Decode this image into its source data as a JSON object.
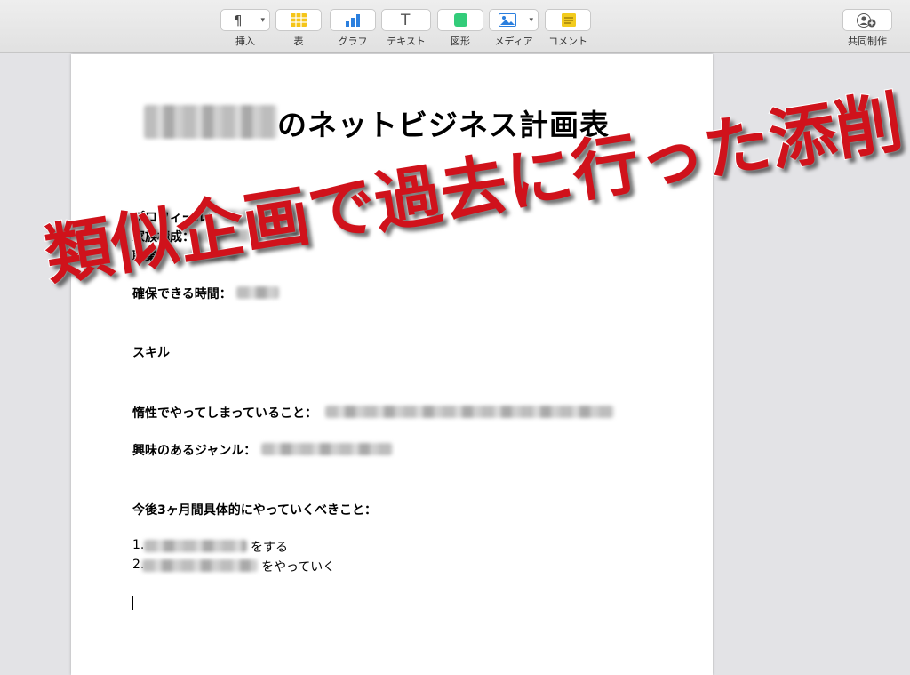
{
  "toolbar": {
    "tools": [
      {
        "name": "insert",
        "label": "挿入",
        "glyph": "¶"
      },
      {
        "name": "table",
        "label": "表"
      },
      {
        "name": "chart",
        "label": "グラフ"
      },
      {
        "name": "text",
        "label": "テキスト",
        "glyph": "T"
      },
      {
        "name": "shape",
        "label": "図形"
      },
      {
        "name": "media",
        "label": "メディア"
      },
      {
        "name": "comment",
        "label": "コメント"
      }
    ],
    "collaborate_label": "共同制作"
  },
  "document": {
    "title_suffix": "のネットビジネス計画表",
    "profile_label": "プロフィール：",
    "family_label": "家族構成：",
    "job_label": "職業：",
    "time_label": "確保できる時間：",
    "skill_label": "スキル",
    "habit_label": "惰性でやってしまっていること：",
    "interest_label": "興味のあるジャンル：",
    "plan_label": "今後3ヶ月間具体的にやっていくべきこと：",
    "item1_prefix": "1.",
    "item1_suffix": "をする",
    "item2_prefix": "2.",
    "item2_suffix": "をやっていく"
  },
  "overlay": {
    "text": "類似企画で過去に行った添削"
  },
  "colors": {
    "overlay": "#d0121b",
    "table_icon": "#f5c518",
    "chart_icon": "#2b7fde",
    "shape_icon": "#33cc7a",
    "comment_icon": "#f2cb1d"
  }
}
